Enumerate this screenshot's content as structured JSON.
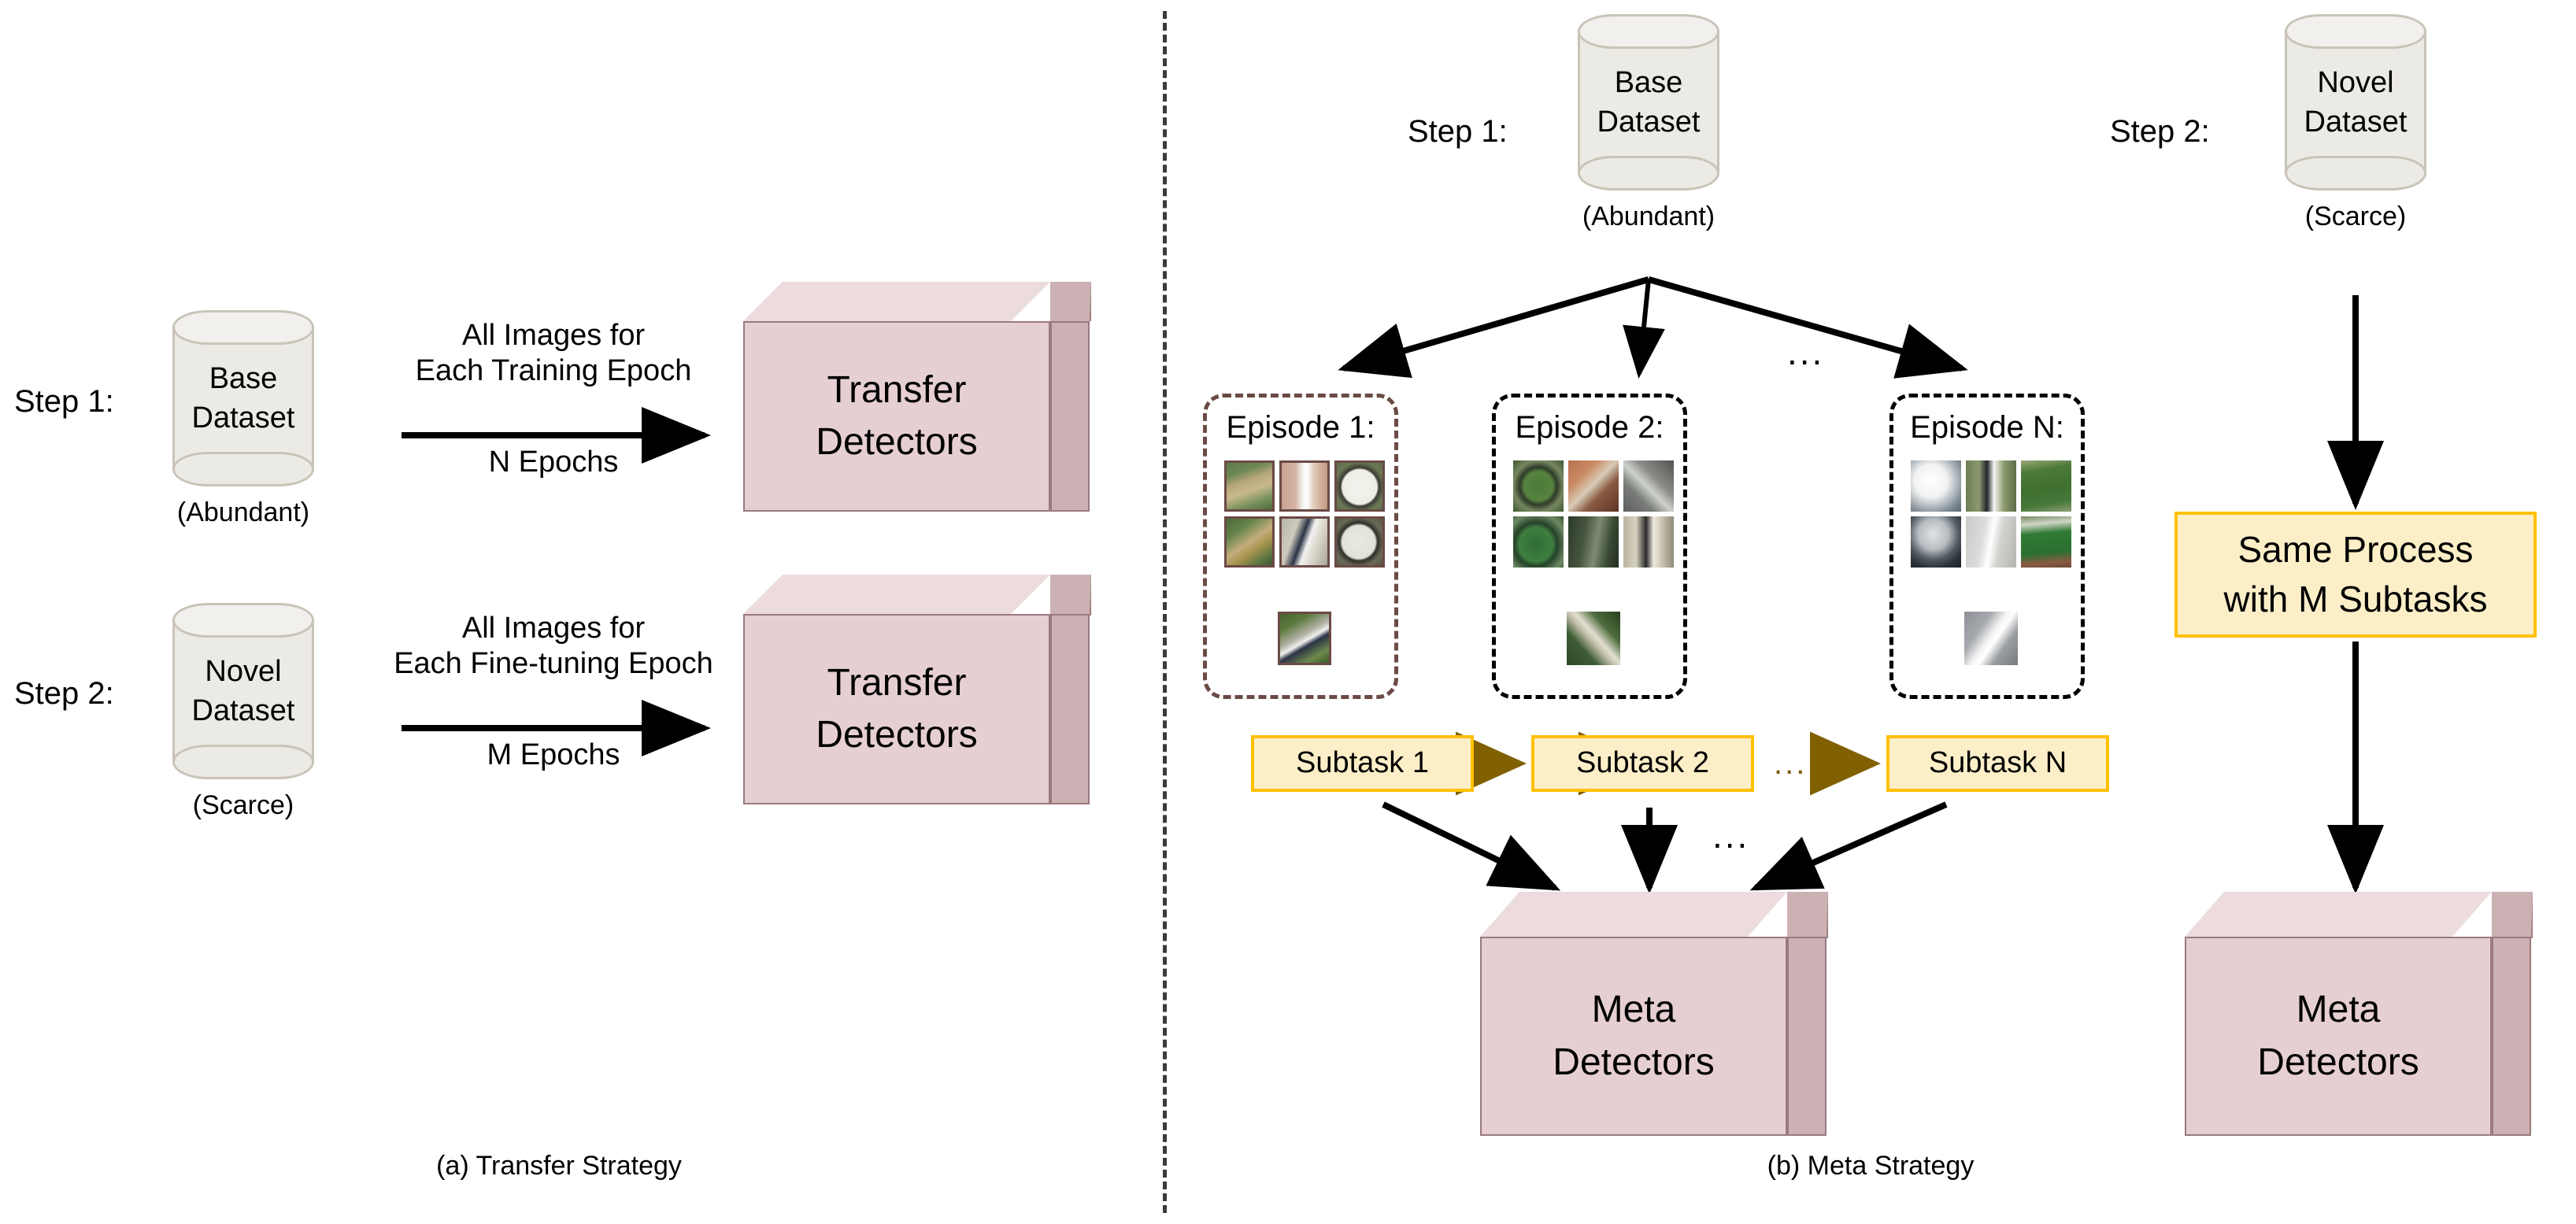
{
  "figure": {
    "left_caption": "(a) Transfer Strategy",
    "right_caption": "(b) Meta Strategy"
  },
  "colors": {
    "detector_box_front": "#e6cfd2",
    "detector_box_top": "#ecdcde",
    "detector_box_side": "#cbb0b4",
    "detector_box_outline": "#9a7a7f",
    "cylinder_fill": "#eceae4",
    "cylinder_outline": "#c9c4b8",
    "subtask_fill": "#fcefc8",
    "subtask_border": "#ffc000",
    "subtask_arrow": "#806000",
    "episode1_border": "#6b4a45",
    "episode_border": "#000000",
    "divider": "#3a3a3a"
  },
  "transfer": {
    "step1": {
      "step_label": "Step 1:",
      "dataset_line1": "Base",
      "dataset_line2": "Dataset",
      "dataset_caption": "(Abundant)",
      "arrow_top_line1": "All Images for",
      "arrow_top_line2": "Each Training Epoch",
      "arrow_bottom": "N Epochs",
      "detector_line1": "Transfer",
      "detector_line2": "Detectors"
    },
    "step2": {
      "step_label": "Step 2:",
      "dataset_line1": "Novel",
      "dataset_line2": "Dataset",
      "dataset_caption": "(Scarce)",
      "arrow_top_line1": "All Images for",
      "arrow_top_line2": "Each Fine-tuning  Epoch",
      "arrow_bottom": "M Epochs",
      "detector_line1": "Transfer",
      "detector_line2": "Detectors"
    }
  },
  "meta": {
    "step1": {
      "step_label": "Step 1:",
      "dataset_line1": "Base",
      "dataset_line2": "Dataset",
      "dataset_caption": "(Abundant)",
      "episodes": [
        {
          "title": "Episode 1:",
          "style": "brown"
        },
        {
          "title": "Episode 2:",
          "style": "black"
        },
        {
          "title": "Episode N:",
          "style": "black"
        }
      ],
      "episodes_ellipsis": "...",
      "subtasks": [
        {
          "label": "Subtask 1"
        },
        {
          "label": "Subtask 2"
        },
        {
          "label": "Subtask N"
        }
      ],
      "subtask_ellipsis": "...",
      "merge_ellipsis": "...",
      "detector_line1": "Meta",
      "detector_line2": "Detectors"
    },
    "step2": {
      "step_label": "Step 2:",
      "dataset_line1": "Novel",
      "dataset_line2": "Dataset",
      "dataset_caption": "(Scarce)",
      "process_line1": "Same Process",
      "process_line2": "with M Subtasks",
      "detector_line1": "Meta",
      "detector_line2": "Detectors"
    }
  }
}
